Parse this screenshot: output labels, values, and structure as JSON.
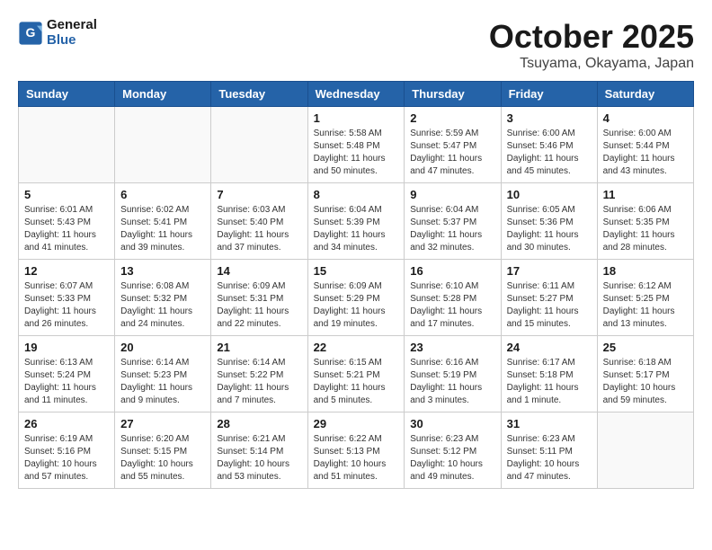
{
  "header": {
    "logo_line1": "General",
    "logo_line2": "Blue",
    "month": "October 2025",
    "location": "Tsuyama, Okayama, Japan"
  },
  "weekdays": [
    "Sunday",
    "Monday",
    "Tuesday",
    "Wednesday",
    "Thursday",
    "Friday",
    "Saturday"
  ],
  "weeks": [
    [
      {
        "day": "",
        "info": ""
      },
      {
        "day": "",
        "info": ""
      },
      {
        "day": "",
        "info": ""
      },
      {
        "day": "1",
        "info": "Sunrise: 5:58 AM\nSunset: 5:48 PM\nDaylight: 11 hours\nand 50 minutes."
      },
      {
        "day": "2",
        "info": "Sunrise: 5:59 AM\nSunset: 5:47 PM\nDaylight: 11 hours\nand 47 minutes."
      },
      {
        "day": "3",
        "info": "Sunrise: 6:00 AM\nSunset: 5:46 PM\nDaylight: 11 hours\nand 45 minutes."
      },
      {
        "day": "4",
        "info": "Sunrise: 6:00 AM\nSunset: 5:44 PM\nDaylight: 11 hours\nand 43 minutes."
      }
    ],
    [
      {
        "day": "5",
        "info": "Sunrise: 6:01 AM\nSunset: 5:43 PM\nDaylight: 11 hours\nand 41 minutes."
      },
      {
        "day": "6",
        "info": "Sunrise: 6:02 AM\nSunset: 5:41 PM\nDaylight: 11 hours\nand 39 minutes."
      },
      {
        "day": "7",
        "info": "Sunrise: 6:03 AM\nSunset: 5:40 PM\nDaylight: 11 hours\nand 37 minutes."
      },
      {
        "day": "8",
        "info": "Sunrise: 6:04 AM\nSunset: 5:39 PM\nDaylight: 11 hours\nand 34 minutes."
      },
      {
        "day": "9",
        "info": "Sunrise: 6:04 AM\nSunset: 5:37 PM\nDaylight: 11 hours\nand 32 minutes."
      },
      {
        "day": "10",
        "info": "Sunrise: 6:05 AM\nSunset: 5:36 PM\nDaylight: 11 hours\nand 30 minutes."
      },
      {
        "day": "11",
        "info": "Sunrise: 6:06 AM\nSunset: 5:35 PM\nDaylight: 11 hours\nand 28 minutes."
      }
    ],
    [
      {
        "day": "12",
        "info": "Sunrise: 6:07 AM\nSunset: 5:33 PM\nDaylight: 11 hours\nand 26 minutes."
      },
      {
        "day": "13",
        "info": "Sunrise: 6:08 AM\nSunset: 5:32 PM\nDaylight: 11 hours\nand 24 minutes."
      },
      {
        "day": "14",
        "info": "Sunrise: 6:09 AM\nSunset: 5:31 PM\nDaylight: 11 hours\nand 22 minutes."
      },
      {
        "day": "15",
        "info": "Sunrise: 6:09 AM\nSunset: 5:29 PM\nDaylight: 11 hours\nand 19 minutes."
      },
      {
        "day": "16",
        "info": "Sunrise: 6:10 AM\nSunset: 5:28 PM\nDaylight: 11 hours\nand 17 minutes."
      },
      {
        "day": "17",
        "info": "Sunrise: 6:11 AM\nSunset: 5:27 PM\nDaylight: 11 hours\nand 15 minutes."
      },
      {
        "day": "18",
        "info": "Sunrise: 6:12 AM\nSunset: 5:25 PM\nDaylight: 11 hours\nand 13 minutes."
      }
    ],
    [
      {
        "day": "19",
        "info": "Sunrise: 6:13 AM\nSunset: 5:24 PM\nDaylight: 11 hours\nand 11 minutes."
      },
      {
        "day": "20",
        "info": "Sunrise: 6:14 AM\nSunset: 5:23 PM\nDaylight: 11 hours\nand 9 minutes."
      },
      {
        "day": "21",
        "info": "Sunrise: 6:14 AM\nSunset: 5:22 PM\nDaylight: 11 hours\nand 7 minutes."
      },
      {
        "day": "22",
        "info": "Sunrise: 6:15 AM\nSunset: 5:21 PM\nDaylight: 11 hours\nand 5 minutes."
      },
      {
        "day": "23",
        "info": "Sunrise: 6:16 AM\nSunset: 5:19 PM\nDaylight: 11 hours\nand 3 minutes."
      },
      {
        "day": "24",
        "info": "Sunrise: 6:17 AM\nSunset: 5:18 PM\nDaylight: 11 hours\nand 1 minute."
      },
      {
        "day": "25",
        "info": "Sunrise: 6:18 AM\nSunset: 5:17 PM\nDaylight: 10 hours\nand 59 minutes."
      }
    ],
    [
      {
        "day": "26",
        "info": "Sunrise: 6:19 AM\nSunset: 5:16 PM\nDaylight: 10 hours\nand 57 minutes."
      },
      {
        "day": "27",
        "info": "Sunrise: 6:20 AM\nSunset: 5:15 PM\nDaylight: 10 hours\nand 55 minutes."
      },
      {
        "day": "28",
        "info": "Sunrise: 6:21 AM\nSunset: 5:14 PM\nDaylight: 10 hours\nand 53 minutes."
      },
      {
        "day": "29",
        "info": "Sunrise: 6:22 AM\nSunset: 5:13 PM\nDaylight: 10 hours\nand 51 minutes."
      },
      {
        "day": "30",
        "info": "Sunrise: 6:23 AM\nSunset: 5:12 PM\nDaylight: 10 hours\nand 49 minutes."
      },
      {
        "day": "31",
        "info": "Sunrise: 6:23 AM\nSunset: 5:11 PM\nDaylight: 10 hours\nand 47 minutes."
      },
      {
        "day": "",
        "info": ""
      }
    ]
  ]
}
